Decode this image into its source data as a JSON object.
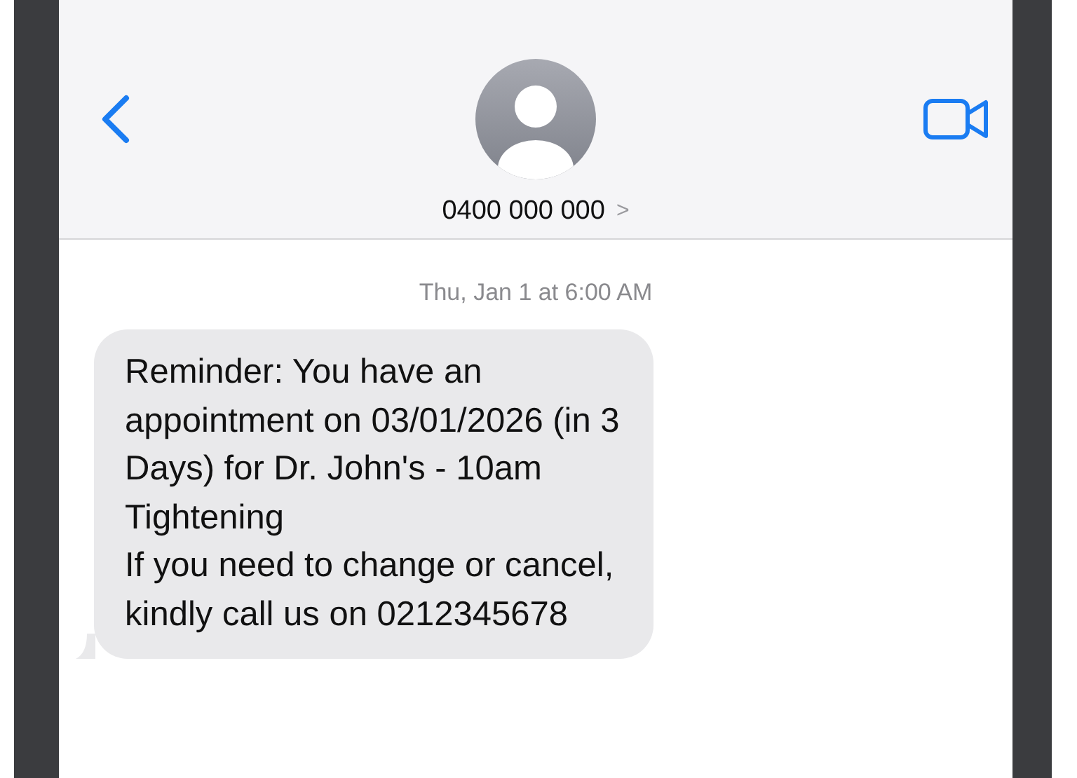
{
  "header": {
    "contact": "0400 000 000",
    "chevron": ">"
  },
  "timestamp": "Thu, Jan 1 at 6:00 AM",
  "messages": [
    {
      "kind": "incoming",
      "text": "Reminder: You have an\nappointment on 03/01/2026 (in 3\nDays) for Dr. John's - 10am\nTightening\nIf you need to change or cancel,\nkindly call us on 0212345678"
    }
  ]
}
